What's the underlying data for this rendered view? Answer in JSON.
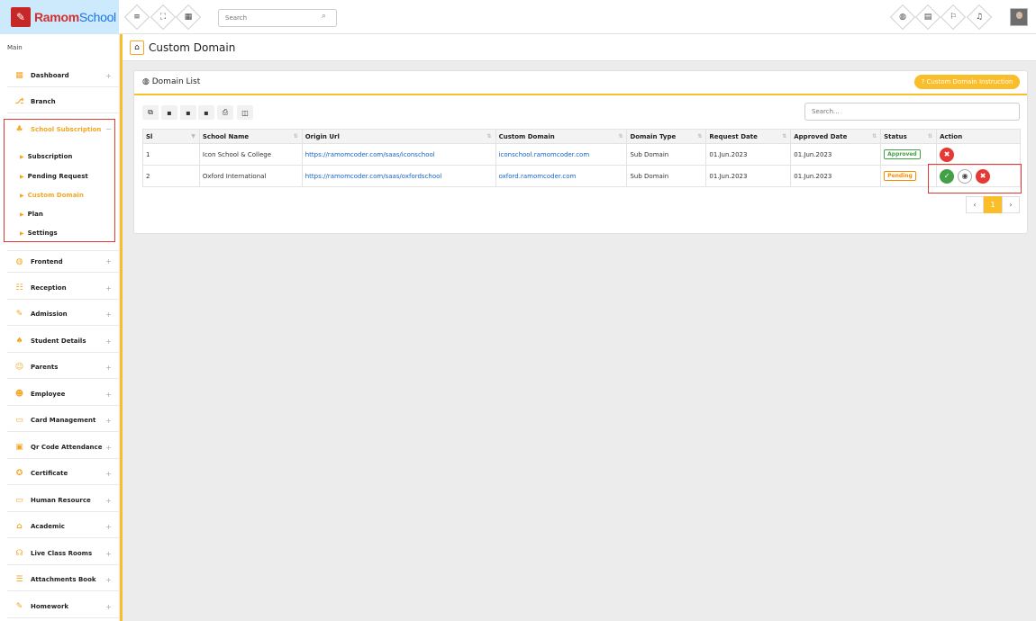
{
  "app": {
    "logo_part1": "Ramom",
    "logo_part2": "School"
  },
  "header": {
    "search_placeholder": "Search",
    "left_icons": [
      "menu-icon",
      "fullscreen-icon",
      "grid-icon"
    ],
    "right_icons": [
      "globe-icon",
      "calendar-icon",
      "flag-icon",
      "bell-icon"
    ]
  },
  "sidebar": {
    "section_label": "Main",
    "items": [
      {
        "label": "Dashboard",
        "icon": "dashboard-icon",
        "expandable": "+"
      },
      {
        "label": "Branch",
        "icon": "branch-icon",
        "expandable": ""
      },
      {
        "label": "School Subscription",
        "icon": "subscription-icon",
        "expandable": "−"
      },
      {
        "label": "Frontend",
        "icon": "frontend-icon",
        "expandable": "+"
      },
      {
        "label": "Reception",
        "icon": "reception-icon",
        "expandable": "+"
      },
      {
        "label": "Admission",
        "icon": "admission-icon",
        "expandable": "+"
      },
      {
        "label": "Student Details",
        "icon": "student-icon",
        "expandable": "+"
      },
      {
        "label": "Parents",
        "icon": "parents-icon",
        "expandable": "+"
      },
      {
        "label": "Employee",
        "icon": "employee-icon",
        "expandable": "+"
      },
      {
        "label": "Card Management",
        "icon": "card-icon",
        "expandable": "+"
      },
      {
        "label": "Qr Code Attendance",
        "icon": "qr-icon",
        "expandable": "+"
      },
      {
        "label": "Certificate",
        "icon": "certificate-icon",
        "expandable": "+"
      },
      {
        "label": "Human Resource",
        "icon": "hr-icon",
        "expandable": "+"
      },
      {
        "label": "Academic",
        "icon": "academic-icon",
        "expandable": "+"
      },
      {
        "label": "Live Class Rooms",
        "icon": "live-class-icon",
        "expandable": "+"
      },
      {
        "label": "Attachments Book",
        "icon": "attachments-icon",
        "expandable": "+"
      },
      {
        "label": "Homework",
        "icon": "homework-icon",
        "expandable": "+"
      }
    ],
    "sub_items": [
      "Subscription",
      "Pending Request",
      "Custom Domain",
      "Plan",
      "Settings"
    ]
  },
  "page": {
    "title": "Custom Domain"
  },
  "panel": {
    "title": "Domain List",
    "instruction_button": "Custom Domain Instruction",
    "search_placeholder": "Search...",
    "toolbar_icons": [
      "copy-icon",
      "csv-icon",
      "excel-icon",
      "pdf-icon",
      "print-icon",
      "columns-icon"
    ]
  },
  "table": {
    "headers": [
      "Sl",
      "School Name",
      "Origin Url",
      "Custom Domain",
      "Domain Type",
      "Request Date",
      "Approved Date",
      "Status",
      "Action"
    ],
    "rows": [
      {
        "sl": "1",
        "school": "Icon School & College",
        "origin": "https://ramomcoder.com/saas/iconschool",
        "domain": "iconschool.ramomcoder.com",
        "type": "Sub Domain",
        "request": "01.Jun.2023",
        "approved": "01.Jun.2023",
        "status": "Approved"
      },
      {
        "sl": "2",
        "school": "Oxford International",
        "origin": "https://ramomcoder.com/saas/oxfordschool",
        "domain": "oxford.ramomcoder.com",
        "type": "Sub Domain",
        "request": "01.Jun.2023",
        "approved": "01.Jun.2023",
        "status": "Pending"
      }
    ]
  },
  "pagination": {
    "prev": "‹",
    "current": "1",
    "next": "›"
  },
  "colors": {
    "accent": "#f9be29",
    "link": "#1565c0",
    "danger": "#e53935",
    "success": "#43a047",
    "warning": "#fb8c00"
  }
}
